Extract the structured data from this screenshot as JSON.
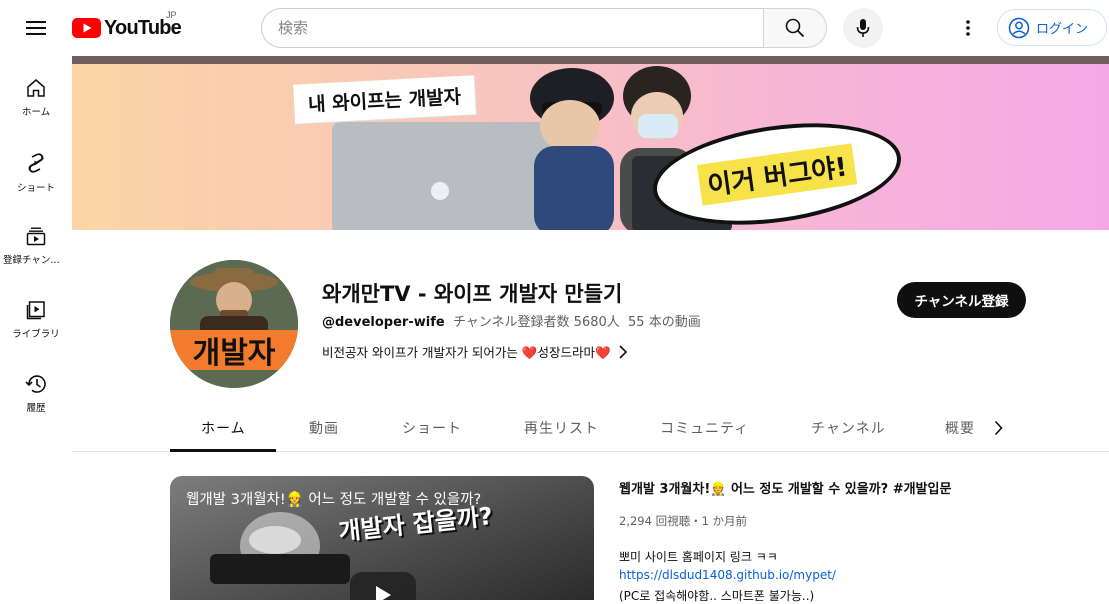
{
  "header": {
    "logo_text": "YouTube",
    "region": "JP",
    "search_placeholder": "検索",
    "login_label": "ログイン",
    "brand_color": "#ff0000"
  },
  "sidebar": {
    "items": [
      {
        "label": "ホーム",
        "icon": "home-icon"
      },
      {
        "label": "ショート",
        "icon": "shorts-icon"
      },
      {
        "label": "登録チャンネル",
        "icon": "subscriptions-icon"
      },
      {
        "label": "ライブラリ",
        "icon": "library-icon"
      },
      {
        "label": "履歴",
        "icon": "history-icon"
      }
    ]
  },
  "banner": {
    "caption": "내 와이프는 개발자",
    "bubble": "이거 버그야!"
  },
  "channel": {
    "avatar_text": "개발자",
    "title": "와개만TV - 와이프 개발자 만들기",
    "handle": "@developer-wife",
    "subscribers": "チャンネル登録者数 5680人",
    "video_count": "55 本の動画",
    "description": "비전공자 와이프가 개발자가 되어가는 ❤️성장드라마❤️",
    "subscribe_label": "チャンネル登録"
  },
  "tabs": [
    {
      "label": "ホーム",
      "active": true
    },
    {
      "label": "動画",
      "active": false
    },
    {
      "label": "ショート",
      "active": false
    },
    {
      "label": "再生リスト",
      "active": false
    },
    {
      "label": "コミュニティ",
      "active": false
    },
    {
      "label": "チャンネル",
      "active": false
    },
    {
      "label": "概要",
      "active": false
    }
  ],
  "featured_video": {
    "thumb_title": "웹개발 3개월차!👷 어느 정도 개발할 수 있을까?",
    "thumb_overlay": "개발자 잡을까?",
    "title": "웹개발 3개월차!👷 어느 정도 개발할 수 있을까? #개발입문",
    "stats": "2,294 回視聴・1 か月前",
    "desc_line1": "뽀미 사이트 홈페이지 링크 ㅋㅋ",
    "desc_link": "https://dlsdud1408.github.io/mypet/",
    "desc_line3": "(PC로 접속해야함.. 스마트폰 불가능..)"
  }
}
